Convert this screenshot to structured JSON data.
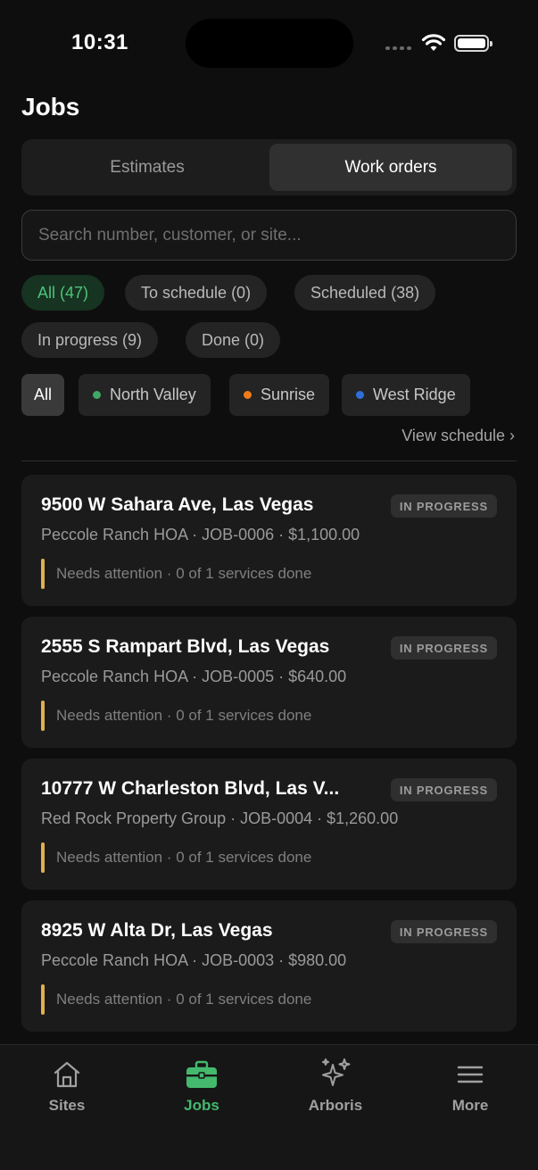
{
  "status_bar": {
    "time": "10:31"
  },
  "header": {
    "title": "Jobs"
  },
  "segments": {
    "estimates": "Estimates",
    "work_orders": "Work orders"
  },
  "search": {
    "placeholder": "Search number, customer, or site...",
    "value": ""
  },
  "status_filters": [
    {
      "label": "All (47)"
    },
    {
      "label": "To schedule (0)"
    },
    {
      "label": "Scheduled (38)"
    },
    {
      "label": "In progress (9)"
    },
    {
      "label": "Done (0)"
    }
  ],
  "area_filters": [
    {
      "label": "All"
    },
    {
      "label": "North Valley",
      "color": "#3fa866"
    },
    {
      "label": "Sunrise",
      "color": "#f07a1a"
    },
    {
      "label": "West Ridge",
      "color": "#2f6fd8"
    }
  ],
  "view_schedule": "View schedule ›",
  "jobs": [
    {
      "address": "9500 W Sahara Ave, Las Vegas",
      "status": "IN PROGRESS",
      "details": "Peccole Ranch HOA · JOB-0006 · $1,100.00",
      "note": "Needs attention · 0 of 1 services done"
    },
    {
      "address": "2555 S Rampart Blvd, Las Vegas",
      "status": "IN PROGRESS",
      "details": "Peccole Ranch HOA · JOB-0005 · $640.00",
      "note": "Needs attention · 0 of 1 services done"
    },
    {
      "address": "10777 W Charleston Blvd, Las V...",
      "status": "IN PROGRESS",
      "details": "Red Rock Property Group · JOB-0004 · $1,260.00",
      "note": "Needs attention · 0 of 1 services done"
    },
    {
      "address": "8925 W Alta Dr, Las Vegas",
      "status": "IN PROGRESS",
      "details": "Peccole Ranch HOA · JOB-0003 · $980.00",
      "note": "Needs attention · 0 of 1 services done"
    }
  ],
  "tabbar": [
    {
      "label": "Sites",
      "icon": "home-icon"
    },
    {
      "label": "Jobs",
      "icon": "briefcase-icon"
    },
    {
      "label": "Arboris",
      "icon": "sparkles-icon"
    },
    {
      "label": "More",
      "icon": "menu-icon"
    }
  ],
  "colors": {
    "accent": "#44b96d",
    "attention": "#e0b04e"
  }
}
